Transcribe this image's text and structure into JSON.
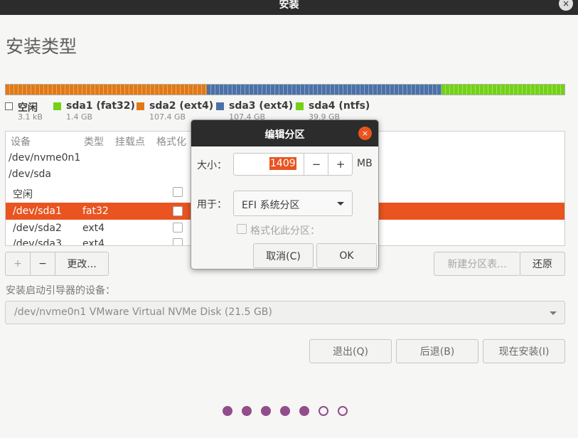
{
  "window": {
    "title": "安装",
    "close_glyph": "×"
  },
  "page": {
    "title": "安装类型"
  },
  "partition_bar": {
    "segments": [
      {
        "name": "sda1 (fat32)",
        "color": "#e07a16",
        "fraction": 0.36
      },
      {
        "name": "sda3 (ext4)",
        "color": "#4a72a8",
        "fraction": 0.42
      },
      {
        "name": "sda4 (ntfs)",
        "color": "#73d216",
        "fraction": 0.22
      }
    ]
  },
  "legend": [
    {
      "name": "空闲",
      "size": "3.1 kB",
      "color": "#ffffff"
    },
    {
      "name": "sda1 (fat32)",
      "size": "1.4 GB",
      "color": "#73d216"
    },
    {
      "name": "sda2 (ext4)",
      "size": "107.4 GB",
      "color": "#e07a16"
    },
    {
      "name": "sda3 (ext4)",
      "size": "107.4 GB",
      "color": "#4a72a8"
    },
    {
      "name": "sda4 (ntfs)",
      "size": "39.9 GB",
      "color": "#73d216"
    }
  ],
  "table": {
    "columns": [
      "设备",
      "类型",
      "挂载点",
      "格式化"
    ],
    "rows": [
      {
        "device": "/dev/nvme0n1",
        "type": ""
      },
      {
        "device": "/dev/sda",
        "type": ""
      },
      {
        "device": "空闲",
        "type": ""
      },
      {
        "device": "/dev/sda1",
        "type": "fat32",
        "selected": true
      },
      {
        "device": "/dev/sda2",
        "type": "ext4"
      },
      {
        "device": "/dev/sda3",
        "type": "ext4"
      }
    ]
  },
  "table_buttons": {
    "add": "+",
    "remove": "−",
    "change": "更改...",
    "new_table": "新建分区表...",
    "revert": "还原"
  },
  "bootloader": {
    "label": "安装启动引导器的设备：",
    "value": "/dev/nvme0n1 VMware Virtual NVMe Disk (21.5 GB)"
  },
  "nav_buttons": {
    "quit": "退出(Q)",
    "back": "后退(B)",
    "install": "现在安装(I)"
  },
  "progress": {
    "total": 7,
    "current": 5,
    "accent": "#924d8b"
  },
  "dialog": {
    "title": "编辑分区",
    "close_glyph": "×",
    "size_label": "大小：",
    "size_value": "1409",
    "size_unit": "MB",
    "minus": "−",
    "plus": "+",
    "use_label": "用于：",
    "use_value": "EFI 系统分区",
    "format_label": "格式化此分区：",
    "cancel": "取消(C)",
    "ok": "OK"
  }
}
